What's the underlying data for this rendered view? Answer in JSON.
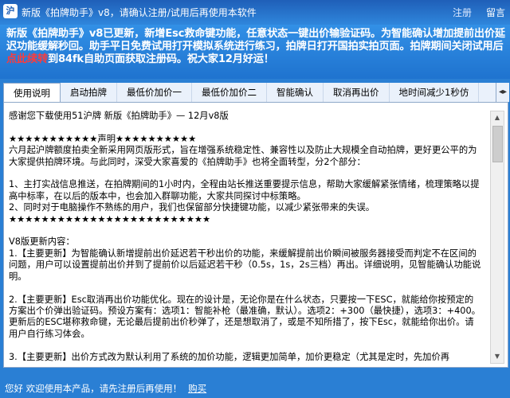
{
  "titlebar": {
    "icon_text": "沪",
    "title": "新版《拍牌助手》v8，请确认注册/试用后再使用本软件",
    "register": "注册",
    "message": "留言"
  },
  "banner": {
    "text_before": "新版《拍牌助手》v8已更新，新增Esc救命键功能，任意状态一键出价输验证码。为智能确认增加提前出价延迟功能缓解秒回。助手平日免费试用打开模拟系统进行练习，拍牌日打开国拍实拍页面。拍牌期间关闭试用后",
    "highlight": "点此续转",
    "text_after": "到84fk自助页面获取注册码。祝大家12月好运！"
  },
  "tabs": [
    {
      "label": "使用说明",
      "active": true
    },
    {
      "label": "启动拍牌"
    },
    {
      "label": "最低价加价一"
    },
    {
      "label": "最低价加价二"
    },
    {
      "label": "智能确认"
    },
    {
      "label": "取消再出价"
    },
    {
      "label": "地时间减少1秒仿"
    }
  ],
  "tab_scroll_glyph": "◂▸",
  "content": {
    "paragraphs": [
      "感谢您下载使用51沪牌 新版《拍牌助手》— 12月v8版",
      "",
      "★★★★★★★★★★★声明★★★★★★★★★★",
      "六月起沪牌额度拍卖全新采用网页版形式，旨在增强系统稳定性、兼容性以及防止大规模全自动拍牌，更好更公平的为大家提供拍牌环境。与此同时，深受大家喜爱的《拍牌助手》也将全面转型，分2个部分：",
      "",
      "1、主打实战信息推送，在拍牌期间的1小时内，全程由站长推送重要提示信息，帮助大家缓解紧张情绪，梳理策略以提高中标率，在以后的版本中，也会加入群聊功能，大家共同探讨中标策略。",
      "2、同时对于电脑操作不熟练的用户，我们也保留部分快捷键功能，以减少紧张带来的失误。",
      "★★★★★★★★★★★★★★★★★★★★★★★★★",
      "",
      "V8版更新内容：",
      "1.【主要更新】为智能确认新增提前出价延迟若干秒出价的功能，来缓解提前出价瞬间被服务器接受而判定不在区间的问题，用户可以设置提前出价并到了提前价以后延迟若干秒（0.5s，1s，2s三档）再出。详细说明，见智能确认功能说明。",
      "",
      "2.【主要更新】Esc取消再出价功能优化。现在的设计是，无论你是在什么状态，只要按一下ESC，就能给你按预定的方案出个价弹出验证码。预设方案有：选项1：智能补枪（最准确，默认）。选项2：+300（最快捷），选项3：+400。更新后的ESC堪称救命键，无论最后提前出价秒弹了，还是想取消了，或是不知所措了，按下Esc，就能给你出价。请用户自行练习体会。",
      "",
      "3.【主要更新】出价方式改为默认利用了系统的加价功能，逻辑更加简单，加价更稳定（尤其是定时，先加价再"
    ]
  },
  "scroll_up_glyph": "▲",
  "scroll_down_glyph": "▼",
  "status": {
    "text": "您好 欢迎使用本产品，请先注册后再使用！",
    "buy": "购买"
  }
}
